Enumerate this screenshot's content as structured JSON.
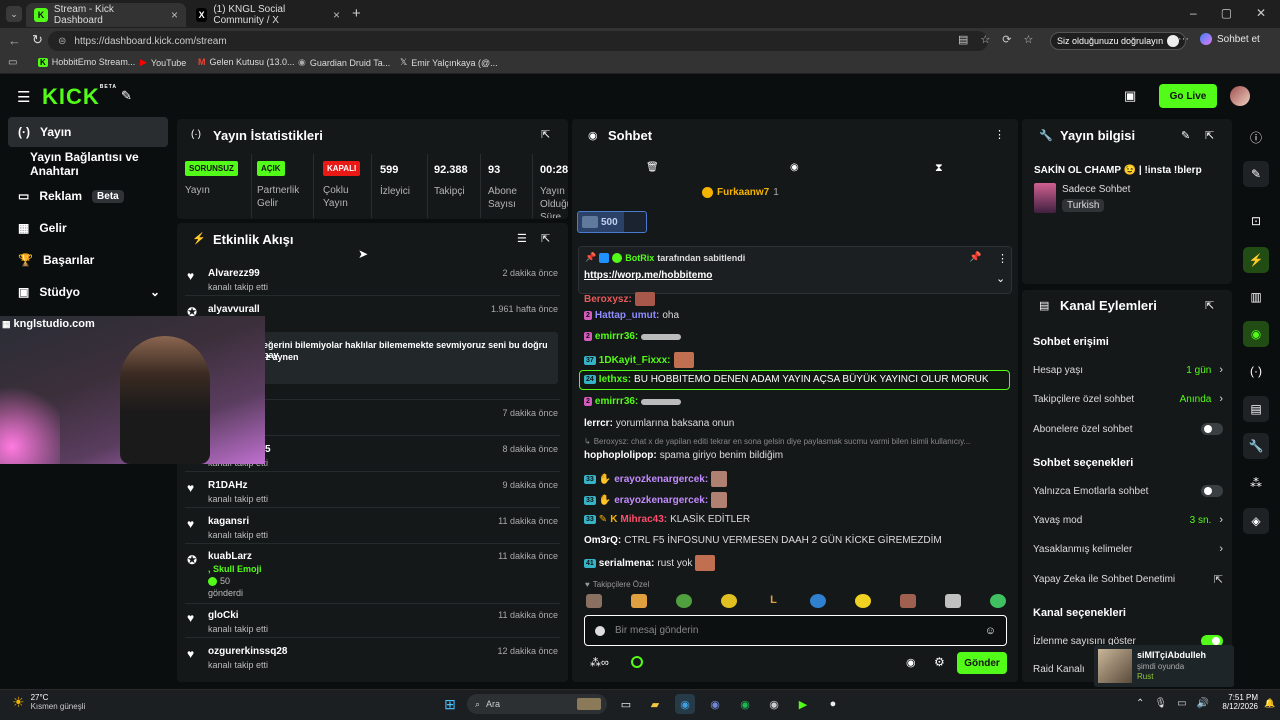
{
  "browser": {
    "tabs": [
      {
        "title": "Stream - Kick Dashboard",
        "icon": "K"
      },
      {
        "title": "(1) KNGL Social Community / X",
        "icon": "X"
      }
    ],
    "url": "https://dashboard.kick.com/stream",
    "verify_label": "Siz olduğunuzu doğrulayın",
    "copilot_label": "Sohbet et",
    "bookmarks": [
      "HobbitEmo Stream...",
      "YouTube",
      "Gelen Kutusu (13.0...",
      "Guardian Druid Ta...",
      "Emir Yalçınkaya (@..."
    ]
  },
  "nav": {
    "logo": "KICK",
    "logo_beta": "BETA",
    "go_live": "Go Live"
  },
  "sidebar": {
    "items": [
      {
        "label": "Yayın",
        "icon": "broadcast-icon"
      },
      {
        "label": "Yayın Bağlantısı ve Anahtarı",
        "icon": ""
      },
      {
        "label": "Reklam",
        "badge": "Beta",
        "icon": "ad-icon"
      },
      {
        "label": "Gelir",
        "icon": "revenue-icon"
      },
      {
        "label": "Başarılar",
        "icon": "trophy-icon"
      },
      {
        "label": "Stüdyo",
        "icon": "studio-icon"
      }
    ]
  },
  "webcam_overlay": "knglstudio.com",
  "stats": {
    "title": "Yayın İstatistikleri",
    "items": [
      {
        "tag": "SORUNSUZ",
        "tag_color": "#53fc18",
        "label": "Yayın"
      },
      {
        "tag": "AÇIK",
        "tag_color": "#53fc18",
        "label": "Partnerlik Gelir"
      },
      {
        "tag": "KAPALI",
        "tag_color": "#e91916",
        "label": "Çoklu Yayın"
      },
      {
        "value": "599",
        "label": "İzleyici"
      },
      {
        "value": "92.388",
        "label": "Takipçi"
      },
      {
        "value": "93",
        "label": "Abone Sayısı"
      },
      {
        "value": "00:28:",
        "label": "Yayın Olduğu Süre"
      }
    ]
  },
  "activity": {
    "title": "Etkinlik Akışı",
    "events": [
      {
        "name": "Alvarezz99",
        "sub": "kanalı takip etti",
        "time": "2 dakika önce"
      },
      {
        "name": "alyavvurall",
        "sub": "",
        "time": "1.961 hafta önce",
        "message": "eğerini bilemiyolar haklılar bilememekte sevmiyoruz seni bu doğru bay",
        "message2": "iz aynen"
      },
      {
        "name": "",
        "sub": "",
        "time": "7 dakika önce"
      },
      {
        "name": "5",
        "sub": "kanalı takip etti",
        "time": "8 dakika önce"
      },
      {
        "name": "R1DAHz",
        "sub": "kanalı takip etti",
        "time": "9 dakika önce"
      },
      {
        "name": "kagansri",
        "sub": "kanalı takip etti",
        "time": "11 dakika önce"
      },
      {
        "name": "kuabLarz",
        "sub": ", Skull Emoji",
        "gift": "50",
        "gift_label": "gönderdi",
        "time": "11 dakika önce"
      },
      {
        "name": "gloCki",
        "sub": "kanalı takip etti",
        "time": "11 dakika önce"
      },
      {
        "name": "ozgurerkinssq28",
        "sub": "kanalı takip etti",
        "time": "12 dakika önce"
      }
    ]
  },
  "chat": {
    "title": "Sohbet",
    "top_gifter": "Furkaanw7",
    "top_gifter_count": "1",
    "goal_value": "500",
    "pinned_by": "BotRix",
    "pinned_label": "tarafından sabitlendi",
    "pinned_link": "https://worp.me/hobbitemo",
    "messages": [
      {
        "user": "Beroxysz:",
        "color": "#e85a5a",
        "text": ""
      },
      {
        "user": "Hattap_umut:",
        "color": "#8e8cff",
        "text": "oha",
        "lvl": "2"
      },
      {
        "user": "emirrr36:",
        "color": "#53fc18",
        "text": "",
        "lvl": "2"
      },
      {
        "user": "1DKayit_Fixxx:",
        "color": "#53fc18",
        "text": "",
        "lvl": "37"
      },
      {
        "user": "Iethxs:",
        "color": "#53fc18",
        "text": "BU HOBBITEMO DENEN ADAM YAYIN AÇSA BÜYÜK YAYINCI OLUR MORUK",
        "lvl": "24",
        "highlight": true
      },
      {
        "user": "emirrr36:",
        "color": "#53fc18",
        "text": "",
        "lvl": "2"
      },
      {
        "user": "lerrcr:",
        "color": "#fff",
        "text": "yorumlarına baksana onun"
      },
      {
        "user": "",
        "color": "#888",
        "text": "Beroxysz: chat x de yapilan editi tekrar en sona gelsin diye paylasmak sucmu varmi bilen isimli kullanıcıy..."
      },
      {
        "user": "hophoplolipop:",
        "color": "#fff",
        "text": "spama giriyo benim bildiğim"
      },
      {
        "user": "erayozkenargercek:",
        "color": "#c28bff",
        "text": "",
        "lvl": "33"
      },
      {
        "user": "erayozkenargercek:",
        "color": "#c28bff",
        "text": "",
        "lvl": "33"
      },
      {
        "user": "Mihrac43:",
        "color": "#ff4d6d",
        "text": "KLASİK EDİTLER",
        "lvl": "33"
      },
      {
        "user": "Om3rQ:",
        "color": "#fff",
        "text": "CTRL F5 İNFOSUNU VERMESEN DAAH 2 GÜN KİCKE GİREMEZDİM"
      },
      {
        "user": "serialmena:",
        "color": "#fff",
        "text": "rust yok",
        "lvl": "41"
      }
    ],
    "followers_only": "Takipçilere Özel",
    "input_placeholder": "Bir mesaj gönderin",
    "send_label": "Gönder"
  },
  "stream_info": {
    "title": "Yayın bilgisi",
    "stream_title": "SAKİN OL CHAMP 😉 | !insta !blerp",
    "category": "Sadece Sohbet",
    "language": "Turkish"
  },
  "channel_actions": {
    "title": "Kanal Eylemleri",
    "chat_access": "Sohbet erişimi",
    "account_age_label": "Hesap yaşı",
    "account_age_value": "1 gün",
    "followers_chat_label": "Takipçilere özel sohbet",
    "followers_chat_value": "Anında",
    "subs_chat_label": "Abonelere özel sohbet",
    "chat_options": "Sohbet seçenekleri",
    "emote_only_label": "Yalnızca Emotlarla sohbet",
    "slow_mode_label": "Yavaş mod",
    "slow_mode_value": "3 sn.",
    "banned_words_label": "Yasaklanmış kelimeler",
    "ai_moderation_label": "Yapay Zeka ile Sohbet Denetimi",
    "channel_options": "Kanal seçenekleri",
    "view_count_label": "İzlenme sayısını göster",
    "raid_label": "Raid Kanalı"
  },
  "notification": {
    "name": "siMITçiAbdulleh",
    "status": "şimdi oyunda",
    "game": "Rust"
  },
  "taskbar": {
    "weather_temp": "27°C",
    "weather_desc": "Kısmen güneşli",
    "search": "Ara",
    "time": "7:51 PM",
    "date": "8/12/2026"
  },
  "colors": {
    "accent": "#53fc18",
    "panel": "#151819",
    "bg": "#0b0e0f"
  }
}
